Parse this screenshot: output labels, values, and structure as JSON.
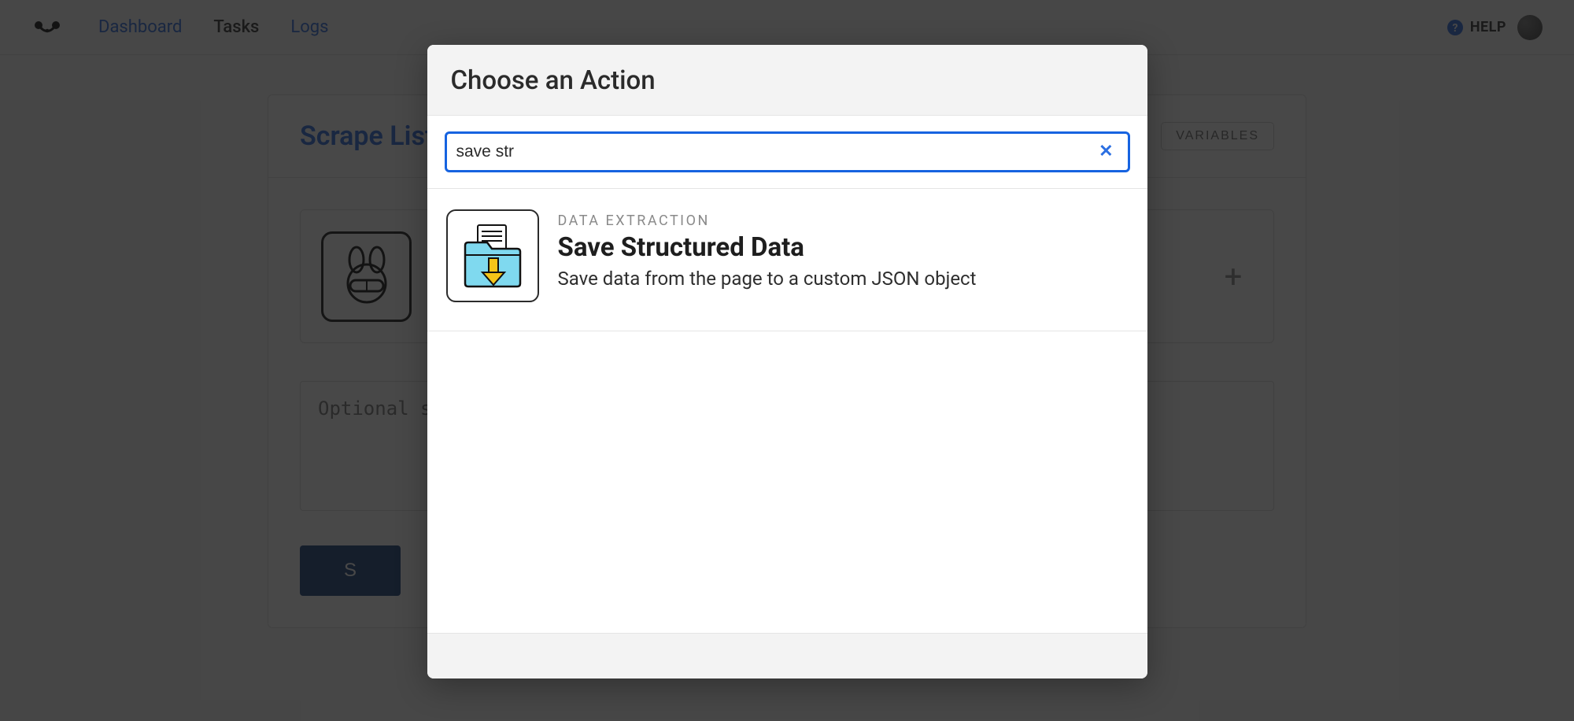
{
  "nav": {
    "links": [
      "Dashboard",
      "Tasks",
      "Logs"
    ],
    "activeIndex": 1,
    "help": "HELP"
  },
  "page": {
    "title": "Scrape List",
    "variablesLabel": "VARIABLES",
    "stepPlaceholder": "Optional step",
    "saveLabel": "S"
  },
  "modal": {
    "title": "Choose an Action",
    "searchValue": "save str",
    "results": [
      {
        "category": "DATA EXTRACTION",
        "title": "Save Structured Data",
        "description": "Save data from the page to a custom JSON object"
      }
    ]
  }
}
